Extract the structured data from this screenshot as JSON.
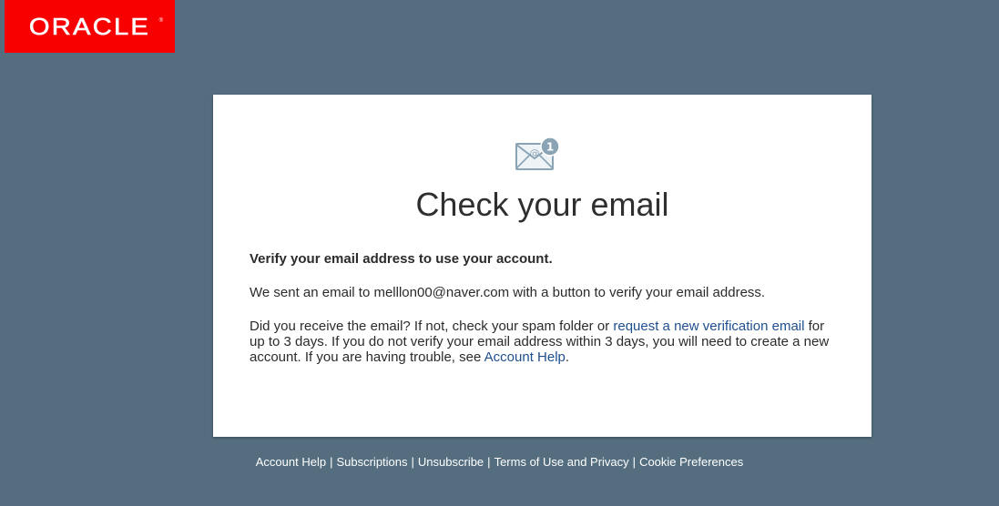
{
  "brand": {
    "logo_text": "ORACLE",
    "logo_mark": "®",
    "logo_color": "#f80000",
    "background_color": "#546e80"
  },
  "card": {
    "icon": "envelope-notification-icon",
    "badge_count": "1",
    "title": "Check your email",
    "heading": "Verify your email address to use your account.",
    "sent_prefix": "We sent an email to ",
    "email": "melllon00@naver.com",
    "sent_suffix": " with a button to verify your email address.",
    "trouble_prefix": "Did you receive the email? If not, check your spam folder or ",
    "resend_link": "request a new verification email",
    "trouble_middle": " for up to 3 days. If you do not verify your email address within 3 days, you will need to create a new account. If you are having trouble, see ",
    "help_link": "Account Help",
    "trouble_suffix": "."
  },
  "footer": {
    "links": [
      "Account Help",
      "Subscriptions",
      "Unsubscribe",
      "Terms of Use and Privacy",
      "Cookie Preferences"
    ],
    "separator": "|"
  }
}
